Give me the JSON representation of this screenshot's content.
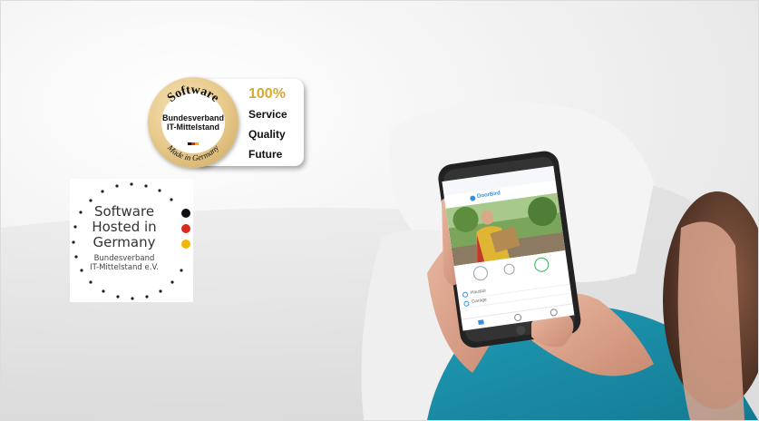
{
  "seal_badge": {
    "arc_top": "Software",
    "org_line1": "Bundesverband",
    "org_line2": "IT-Mittelstand",
    "arc_bottom": "Made in Germany",
    "percent": "100%",
    "lines": [
      "Service",
      "Quality",
      "Future"
    ],
    "gold": "#d9a92e"
  },
  "hosted_badge": {
    "lines": [
      "Software",
      "Hosted in",
      "Germany"
    ],
    "org_line1": "Bundesverband",
    "org_line2": "IT-Mittelstand e.V.",
    "dot_colors": [
      "#111111",
      "#d62b1e",
      "#f2b705"
    ]
  },
  "phone_app": {
    "brand": "DoorBird",
    "list_items": [
      "Haustür",
      "Garage"
    ],
    "accent": "#3a8fd9",
    "accept_color": "#2fae4e"
  },
  "icons": {
    "key": "key-icon",
    "accept": "phone-accept-icon",
    "home": "home-tab-icon",
    "history": "history-tab-icon",
    "settings": "settings-tab-icon"
  }
}
